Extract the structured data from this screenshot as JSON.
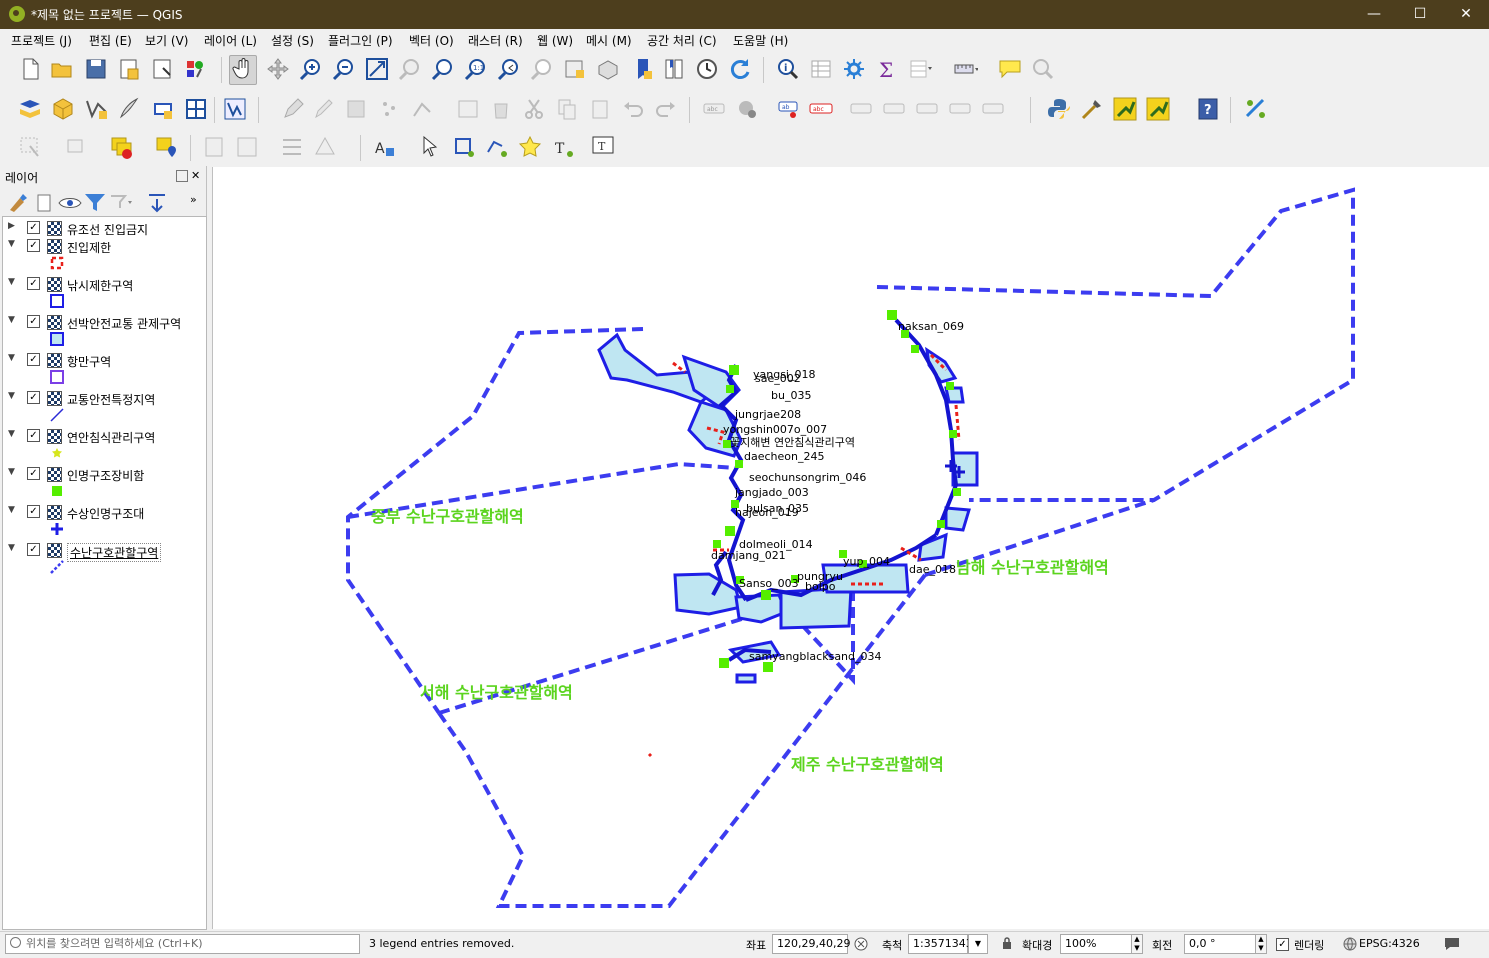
{
  "window": {
    "title": "*제목 없는 프로젝트 — QGIS",
    "minimize": "—",
    "maximize": "☐",
    "close": "✕"
  },
  "menu": [
    "프로젝트 (J)",
    "편집 (E)",
    "보기 (V)",
    "레이어 (L)",
    "설정 (S)",
    "플러그인 (P)",
    "벡터 (O)",
    "래스터 (R)",
    "웹 (W)",
    "메시 (M)",
    "공간 처리 (C)",
    "도움말 (H)"
  ],
  "layers_panel": {
    "title": "레이어",
    "layers": [
      {
        "name": "유조선 진입금지",
        "checked": true,
        "expanded": false
      },
      {
        "name": "진입제한",
        "checked": true,
        "expanded": true
      },
      {
        "name": "낚시제한구역",
        "checked": true,
        "expanded": true
      },
      {
        "name": "선박안전교통 관제구역",
        "checked": true,
        "expanded": true
      },
      {
        "name": "항만구역",
        "checked": true,
        "expanded": true
      },
      {
        "name": "교통안전특정지역",
        "checked": true,
        "expanded": true
      },
      {
        "name": "연안침식관리구역",
        "checked": true,
        "expanded": true
      },
      {
        "name": "인명구조장비함",
        "checked": true,
        "expanded": true
      },
      {
        "name": "수상인명구조대",
        "checked": true,
        "expanded": true
      },
      {
        "name": "수난구호관할구역",
        "checked": true,
        "expanded": true
      }
    ]
  },
  "map": {
    "region_labels": [
      "중부 수난구호관할해역",
      "남해 수난구호관할해역",
      "서해 수난구호관할해역",
      "제주 수난구호관할해역"
    ],
    "feature_labels": [
      "naksan_069",
      "yangsi_018",
      "sae_002",
      "bu_035",
      "jungrjae208",
      "yongshin007o_007",
      "꽃지해변 연안침식관리구역",
      "daecheon_245",
      "seochunsongrim_046",
      "jangjado_003",
      "bulsan_035",
      "hajeon_019",
      "dolmeoli_014",
      "damjang_021",
      "Sanso_003",
      "pungryu",
      "bolpo",
      "yup_004",
      "dae_018",
      "samyangblacksand_034"
    ],
    "colors": {
      "zone_line": "#3c3cf0",
      "polygon_fill": "#bfe6f2",
      "polygon_stroke": "#1e1ee6",
      "restricted": "#e8201a",
      "rescue_box": "#55ee00",
      "label_big": "#5bd41e"
    }
  },
  "status": {
    "search_placeholder": "위치를 찾으려면 입력하세요 (Ctrl+K)",
    "message": "3 legend entries removed.",
    "coord_label": "좌표",
    "coord_value": "120,29,40,29",
    "scale_label": "축척",
    "scale_value": "1:3571343",
    "magnifier_label": "확대경",
    "magnifier_value": "100%",
    "rotation_label": "회전",
    "rotation_value": "0,0 °",
    "render_label": "렌더링",
    "crs": "EPSG:4326"
  }
}
